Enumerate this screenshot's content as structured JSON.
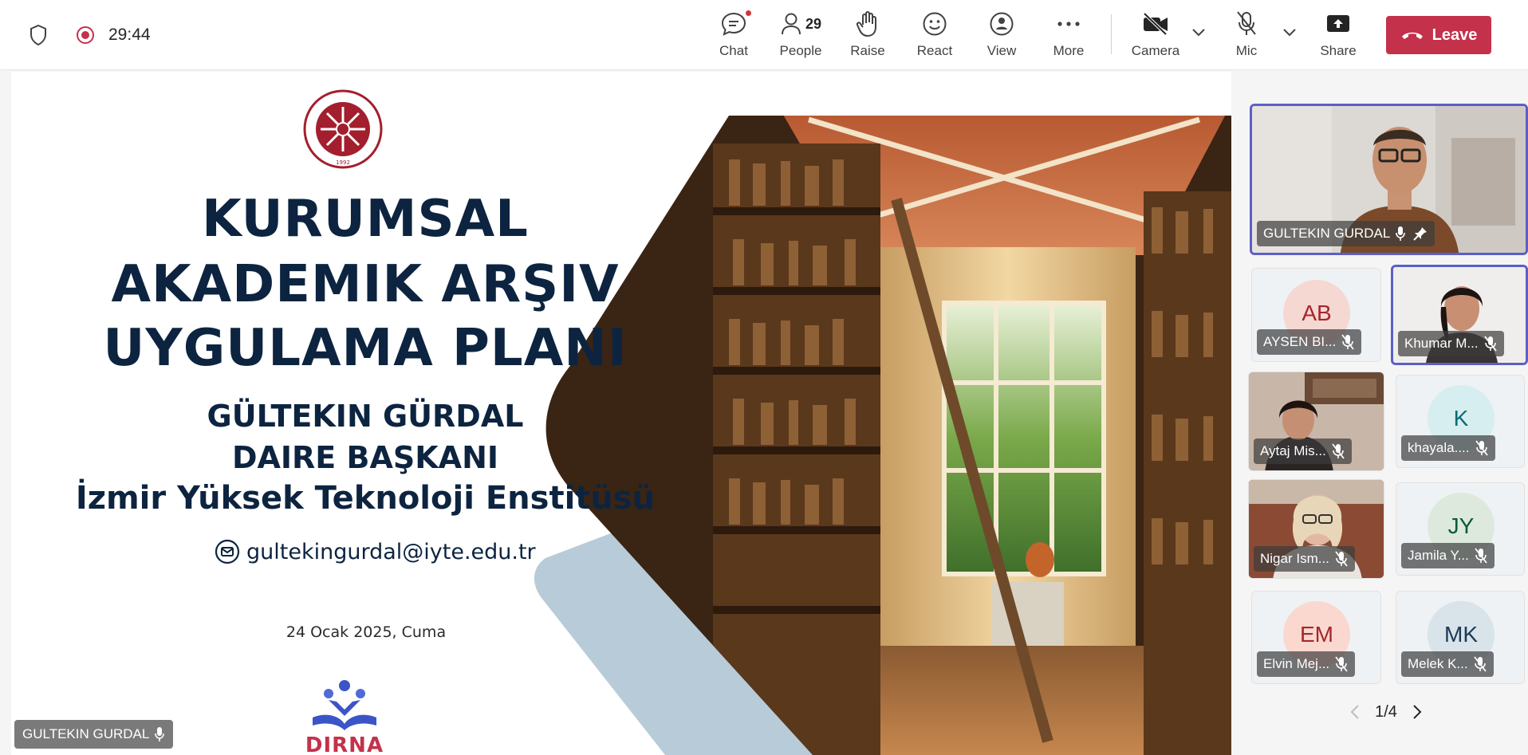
{
  "toolbar": {
    "timer": "29:44",
    "chat_label": "Chat",
    "people_label": "People",
    "people_count": "29",
    "raise_label": "Raise",
    "react_label": "React",
    "view_label": "View",
    "more_label": "More",
    "camera_label": "Camera",
    "mic_label": "Mic",
    "share_label": "Share",
    "leave_label": "Leave"
  },
  "colors": {
    "leave": "#c4314b",
    "active_speaker_border": "#5b5fc7",
    "slide_title": "#0d2440",
    "notification_dot": "#d13438"
  },
  "slide": {
    "title_line1": "KURUMSAL",
    "title_line2": "AKADEMIK ARŞIV",
    "title_line3": "UYGULAMA PLANI",
    "presenter_name": "GÜLTEKIN GÜRDAL",
    "presenter_role": "DAIRE BAŞKANI",
    "institution": "İzmir Yüksek Teknoloji Enstitüsü",
    "email": "gultekingurdal@iyte.edu.tr",
    "date": "24 Ocak 2025, Cuma",
    "brand_logo": "DIRNA",
    "seal_year": "1992"
  },
  "presenter_label": "GULTEKIN GURDAL",
  "participants": [
    {
      "name": "GULTEKIN GURDAL",
      "type": "video",
      "mic": "on",
      "pinned": true
    },
    {
      "name": "AYSEN BI...",
      "initials": "AB",
      "type": "avatar",
      "mic": "muted"
    },
    {
      "name": "Khumar M...",
      "type": "video",
      "mic": "muted"
    },
    {
      "name": "Aytaj Mis...",
      "type": "video",
      "mic": "muted"
    },
    {
      "name": "khayala....",
      "initials": "K",
      "type": "avatar",
      "mic": "muted"
    },
    {
      "name": "Nigar Ism...",
      "type": "video",
      "mic": "muted"
    },
    {
      "name": "Jamila Y...",
      "initials": "JY",
      "type": "avatar",
      "mic": "muted"
    },
    {
      "name": "Elvin Mej...",
      "initials": "EM",
      "type": "avatar",
      "mic": "muted"
    },
    {
      "name": "Melek K...",
      "initials": "MK",
      "type": "avatar",
      "mic": "muted"
    }
  ],
  "pager": {
    "text": "1/4"
  }
}
